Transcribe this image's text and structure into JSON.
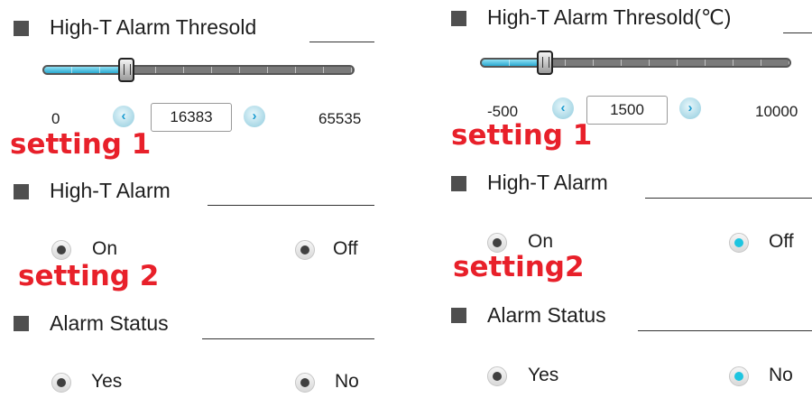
{
  "left": {
    "threshold": {
      "label": "High-T Alarm Thresold",
      "min": "0",
      "value": "16383",
      "max": "65535",
      "slider_level": 0.25
    },
    "decrement_icon": "chevron-left-icon",
    "increment_icon": "chevron-right-icon",
    "setting1_label": "setting 1",
    "alarm": {
      "label": "High-T Alarm",
      "on_label": "On",
      "off_label": "Off"
    },
    "setting2_label": "setting 2",
    "status": {
      "label": "Alarm Status",
      "yes_label": "Yes",
      "no_label": "No"
    }
  },
  "right": {
    "threshold": {
      "label": "High-T Alarm Thresold(℃)",
      "min": "-500",
      "value": "1500",
      "max": "10000",
      "slider_level": 0.19
    },
    "decrement_icon": "chevron-left-icon",
    "increment_icon": "chevron-right-icon",
    "setting1_label": "setting 1",
    "alarm": {
      "label": "High-T Alarm",
      "on_label": "On",
      "off_label": "Off"
    },
    "setting2_label": "setting2",
    "status": {
      "label": "Alarm Status",
      "yes_label": "Yes",
      "no_label": "No"
    }
  },
  "colors": {
    "accent": "#1ec5e0",
    "tag_red": "#e8202a",
    "radio_dark": "#404040"
  }
}
